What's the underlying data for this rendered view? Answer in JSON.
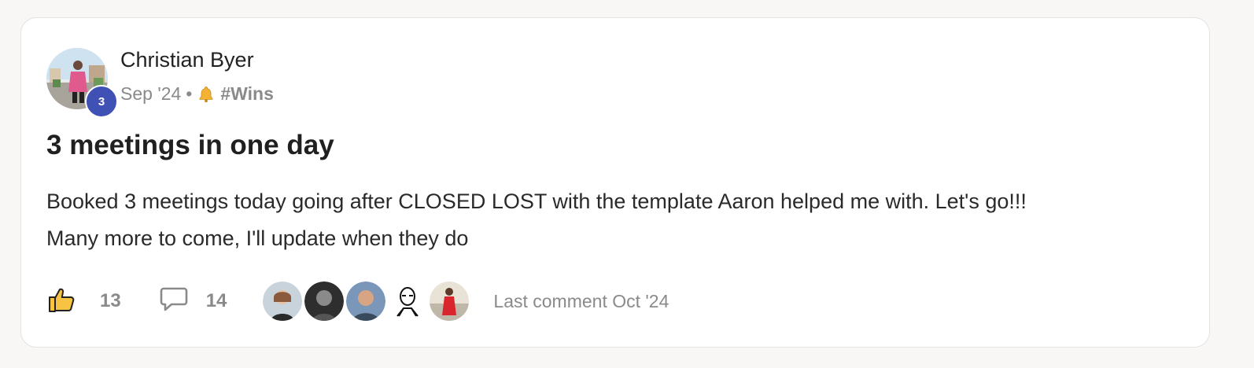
{
  "post": {
    "author": {
      "name": "Christian Byer",
      "level": "3",
      "avatar_icon": "profile-photo"
    },
    "meta": {
      "date": "Sep '24",
      "separator": "•",
      "category_icon": "bell-icon",
      "category": "#Wins"
    },
    "title": "3 meetings in one day",
    "body_lines": [
      "Booked 3 meetings today going after CLOSED LOST with the template Aaron helped me with. Let's go!!!",
      "Many more to come, I'll update when they do"
    ],
    "footer": {
      "like_icon": "thumbs-up-icon",
      "like_count": "13",
      "comment_icon": "comment-icon",
      "comment_count": "14",
      "participant_avatars": [
        "participant-1",
        "participant-2",
        "participant-3",
        "participant-4",
        "participant-5"
      ],
      "last_comment": "Last comment Oct '24"
    }
  },
  "colors": {
    "background": "#f8f7f5",
    "card": "#ffffff",
    "level_badge": "#3f51b5",
    "muted_text": "#8a8a8a",
    "like_icon": "#f6c343"
  }
}
